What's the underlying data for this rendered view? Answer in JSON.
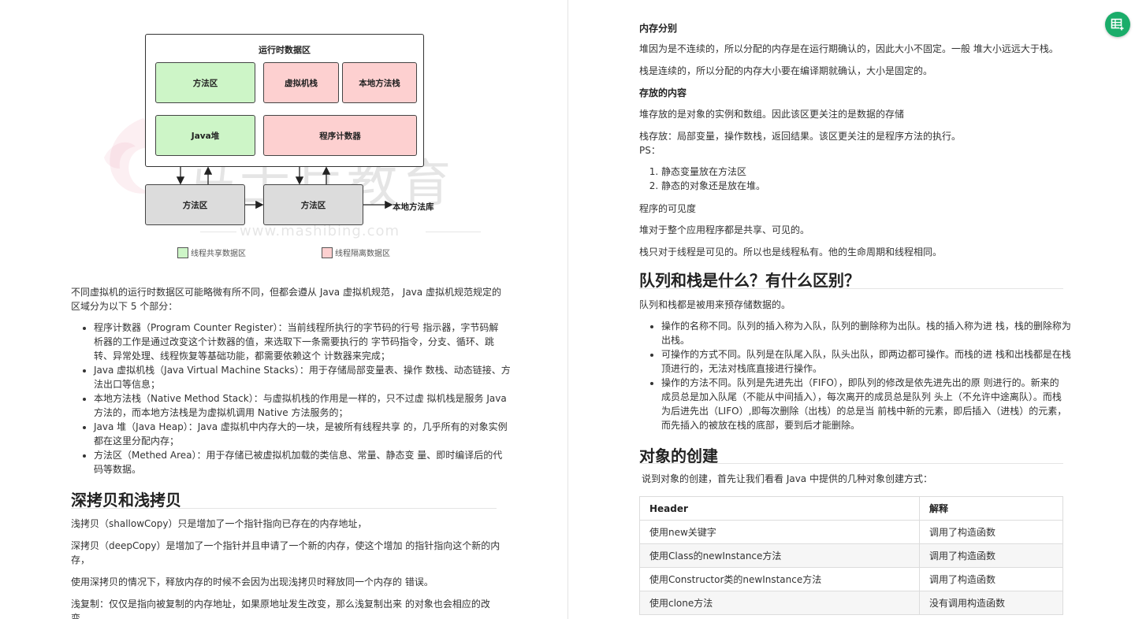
{
  "diagram": {
    "title": "运行时数据区",
    "cells": {
      "method_area": "方法区",
      "vm_stack": "虚拟机栈",
      "native_stack": "本地方法栈",
      "java_heap": "Java堆",
      "pc_register": "程序计数器",
      "bottom_left": "方法区",
      "bottom_right": "方法区"
    },
    "native_lib": "本地方法库",
    "legend_shared": "线程共享数据区",
    "legend_isolated": "线程隔离数据区",
    "watermark": "马士兵教育",
    "watermark_url": "www.mashibing.com",
    "colors": {
      "shared": "#cdf5c7",
      "isolated": "#fdd0d0",
      "other": "#dcdcdc"
    }
  },
  "left": {
    "intro_line1": "不同虚拟机的运行时数据区可能略微有所不同，但都会遵从 Java 虚拟机规范， Java 虚拟机规范规定的",
    "intro_line2": "区域分为以下 5 个部分：",
    "bullets": [
      [
        "程序计数器（Program Counter Register）：当前线程所执行的字节码的行号 指示器，字节码解",
        "析器的工作是通过改变这个计数器的值，来选取下一条需要执行的 字节码指令，分支、循环、跳",
        "转、异常处理、线程恢复等基础功能，都需要依赖这个 计数器来完成；"
      ],
      [
        "Java 虚拟机栈（Java Virtual Machine Stacks）：用于存储局部变量表、操作 数栈、动态链接、方",
        "法出口等信息；"
      ],
      [
        "本地方法栈（Native Method Stack）：与虚拟机栈的作用是一样的，只不过虚 拟机栈是服务 Java",
        "方法的，而本地方法栈是为虚拟机调用 Native 方法服务的；"
      ],
      [
        "Java 堆（Java Heap）：Java 虚拟机中内存大的一块，是被所有线程共享 的，几乎所有的对象实例",
        "都在这里分配内存；"
      ],
      [
        "方法区（Methed Area）：用于存储已被虚拟机加载的类信息、常量、静态变 量、即时编译后的代",
        "码等数据。"
      ]
    ],
    "h2_copy": "深拷贝和浅拷贝",
    "shallow": "浅拷贝（shallowCopy）只是增加了一个指针指向已存在的内存地址，",
    "deep_line1": "深拷贝（deepCopy）是增加了一个指针并且申请了一个新的内存，使这个增加 的指针指向这个新的内",
    "deep_line2": "存，",
    "deep_note": "使用深拷贝的情况下，释放内存的时候不会因为出现浅拷贝时释放同一个内存的 错误。",
    "shallow_copy_line1": "浅复制：仅仅是指向被复制的内存地址，如果原地址发生改变，那么浅复制出来 的对象也会相应的改",
    "shallow_copy_line2": "变。"
  },
  "right": {
    "h_mem": "内存分别",
    "mem_p1": "堆因为是不连续的，所以分配的内存是在运行期确认的，因此大小不固定。一般 堆大小远远大于栈。",
    "mem_p2": "栈是连续的，所以分配的内存大小要在编译期就确认，大小是固定的。",
    "h_store": "存放的内容",
    "store_p1": "堆存放的是对象的实例和数组。因此该区更关注的是数据的存储",
    "store_p2": "栈存放：局部变量，操作数栈，返回结果。该区更关注的是程序方法的执行。",
    "ps": "PS：",
    "ps_items": [
      "静态变量放在方法区",
      "静态的对象还是放在堆。"
    ],
    "visibility": "程序的可见度",
    "vis_p1": "堆对于整个应用程序都是共享、可见的。",
    "vis_p2": "栈只对于线程是可见的。所以也是线程私有。他的生命周期和线程相同。",
    "h2_queue": "队列和栈是什么？有什么区别？",
    "queue_intro": "队列和栈都是被用来预存储数据的。",
    "queue_bullets": [
      [
        "操作的名称不同。队列的插入称为入队，队列的删除称为出队。栈的插入称为进 栈，栈的删除称为",
        "出栈。"
      ],
      [
        "可操作的方式不同。队列是在队尾入队，队头出队，即两边都可操作。而栈的进 栈和出栈都是在栈",
        "顶进行的，无法对栈底直接进行操作。"
      ],
      [
        "操作的方法不同。队列是先进先出（FIFO），即队列的修改是依先进先出的原 则进行的。新来的",
        "成员总是加入队尾（不能从中间插入），每次离开的成员总是队列 头上（不允许中途离队）。而栈",
        "为后进先出（LIFO）,即每次删除（出栈）的总是当 前栈中新的元素，即后插入（进栈）的元素，",
        "而先插入的被放在栈的底部，要到后才能删除。"
      ]
    ],
    "h2_object": "对象的创建",
    "object_intro": "说到对象的创建，首先让我们看看 Java 中提供的几种对象创建方式：",
    "table": {
      "headers": [
        "Header",
        "解释"
      ],
      "rows": [
        [
          "使用new关键字",
          "调用了构造函数"
        ],
        [
          "使用Class的newInstance方法",
          "调用了构造函数"
        ],
        [
          "使用Constructor类的newInstance方法",
          "调用了构造函数"
        ],
        [
          "使用clone方法",
          "没有调用构造函数"
        ]
      ]
    }
  },
  "fab_icon": "table-plus-icon"
}
